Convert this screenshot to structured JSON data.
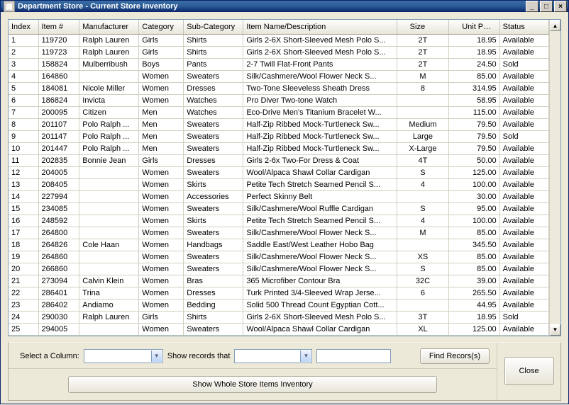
{
  "window": {
    "title": "Department Store - Current Store Inventory",
    "min_btn": "_",
    "max_btn": "□",
    "close_btn": "×"
  },
  "columns": {
    "index": "Index",
    "itemno": "Item #",
    "manufacturer": "Manufacturer",
    "category": "Category",
    "subcategory": "Sub-Category",
    "name": "Item Name/Description",
    "size": "Size",
    "unitprice": "Unit Price",
    "status": "Status"
  },
  "rows": [
    {
      "index": "1",
      "itemno": "119720",
      "manufacturer": "Ralph Lauren",
      "category": "Girls",
      "subcategory": "Shirts",
      "name": "Girls 2-6X Short-Sleeved Mesh Polo S...",
      "size": "2T",
      "unitprice": "18.95",
      "status": "Available"
    },
    {
      "index": "2",
      "itemno": "119723",
      "manufacturer": "Ralph Lauren",
      "category": "Girls",
      "subcategory": "Shirts",
      "name": "Girls 2-6X Short-Sleeved Mesh Polo S...",
      "size": "2T",
      "unitprice": "18.95",
      "status": "Available"
    },
    {
      "index": "3",
      "itemno": "158824",
      "manufacturer": "Mulberribush",
      "category": "Boys",
      "subcategory": "Pants",
      "name": "2-7 Twill Flat-Front Pants",
      "size": "2T",
      "unitprice": "24.50",
      "status": "Sold"
    },
    {
      "index": "4",
      "itemno": "164860",
      "manufacturer": "",
      "category": "Women",
      "subcategory": "Sweaters",
      "name": "Silk/Cashmere/Wool Flower Neck S...",
      "size": "M",
      "unitprice": "85.00",
      "status": "Available"
    },
    {
      "index": "5",
      "itemno": "184081",
      "manufacturer": "Nicole Miller",
      "category": "Women",
      "subcategory": "Dresses",
      "name": "Two-Tone Sleeveless Sheath Dress",
      "size": "8",
      "unitprice": "314.95",
      "status": "Available"
    },
    {
      "index": "6",
      "itemno": "186824",
      "manufacturer": "Invicta",
      "category": "Women",
      "subcategory": "Watches",
      "name": "Pro Diver Two-tone Watch",
      "size": "",
      "unitprice": "58.95",
      "status": "Available"
    },
    {
      "index": "7",
      "itemno": "200095",
      "manufacturer": "Citizen",
      "category": "Men",
      "subcategory": "Watches",
      "name": "Eco-Drive Men's Titanium Bracelet W...",
      "size": "",
      "unitprice": "115.00",
      "status": "Available"
    },
    {
      "index": "8",
      "itemno": "201107",
      "manufacturer": "Polo Ralph ...",
      "category": "Men",
      "subcategory": "Sweaters",
      "name": "Half-Zip Ribbed Mock-Turtleneck Sw...",
      "size": "Medium",
      "unitprice": "79.50",
      "status": "Available"
    },
    {
      "index": "9",
      "itemno": "201147",
      "manufacturer": "Polo Ralph ...",
      "category": "Men",
      "subcategory": "Sweaters",
      "name": "Half-Zip Ribbed Mock-Turtleneck Sw...",
      "size": "Large",
      "unitprice": "79.50",
      "status": "Sold"
    },
    {
      "index": "10",
      "itemno": "201447",
      "manufacturer": "Polo Ralph ...",
      "category": "Men",
      "subcategory": "Sweaters",
      "name": "Half-Zip Ribbed Mock-Turtleneck Sw...",
      "size": "X-Large",
      "unitprice": "79.50",
      "status": "Available"
    },
    {
      "index": "11",
      "itemno": "202835",
      "manufacturer": "Bonnie Jean",
      "category": "Girls",
      "subcategory": "Dresses",
      "name": "Girls 2-6x Two-For Dress & Coat",
      "size": "4T",
      "unitprice": "50.00",
      "status": "Available"
    },
    {
      "index": "12",
      "itemno": "204005",
      "manufacturer": "",
      "category": "Women",
      "subcategory": "Sweaters",
      "name": "Wool/Alpaca Shawl Collar Cardigan",
      "size": "S",
      "unitprice": "125.00",
      "status": "Available"
    },
    {
      "index": "13",
      "itemno": "208405",
      "manufacturer": "",
      "category": "Women",
      "subcategory": "Skirts",
      "name": "Petite Tech Stretch Seamed Pencil S...",
      "size": "4",
      "unitprice": "100.00",
      "status": "Available"
    },
    {
      "index": "14",
      "itemno": "227994",
      "manufacturer": "",
      "category": "Women",
      "subcategory": "Accessories",
      "name": "Perfect Skinny Belt",
      "size": "",
      "unitprice": "30.00",
      "status": "Available"
    },
    {
      "index": "15",
      "itemno": "234085",
      "manufacturer": "",
      "category": "Women",
      "subcategory": "Sweaters",
      "name": "Silk/Cashmere/Wool Ruffle Cardigan",
      "size": "S",
      "unitprice": "95.00",
      "status": "Available"
    },
    {
      "index": "16",
      "itemno": "248592",
      "manufacturer": "",
      "category": "Women",
      "subcategory": "Skirts",
      "name": "Petite Tech Stretch Seamed Pencil S...",
      "size": "4",
      "unitprice": "100.00",
      "status": "Available"
    },
    {
      "index": "17",
      "itemno": "264800",
      "manufacturer": "",
      "category": "Women",
      "subcategory": "Sweaters",
      "name": "Silk/Cashmere/Wool Flower Neck S...",
      "size": "M",
      "unitprice": "85.00",
      "status": "Available"
    },
    {
      "index": "18",
      "itemno": "264826",
      "manufacturer": "Cole Haan",
      "category": "Women",
      "subcategory": "Handbags",
      "name": "Saddle East/West Leather Hobo Bag",
      "size": "",
      "unitprice": "345.50",
      "status": "Available"
    },
    {
      "index": "19",
      "itemno": "264860",
      "manufacturer": "",
      "category": "Women",
      "subcategory": "Sweaters",
      "name": "Silk/Cashmere/Wool Flower Neck S...",
      "size": "XS",
      "unitprice": "85.00",
      "status": "Available"
    },
    {
      "index": "20",
      "itemno": "266860",
      "manufacturer": "",
      "category": "Women",
      "subcategory": "Sweaters",
      "name": "Silk/Cashmere/Wool Flower Neck S...",
      "size": "S",
      "unitprice": "85.00",
      "status": "Available"
    },
    {
      "index": "21",
      "itemno": "273094",
      "manufacturer": "Calvin Klein",
      "category": "Women",
      "subcategory": "Bras",
      "name": "365 Microfiber Contour Bra",
      "size": "32C",
      "unitprice": "39.00",
      "status": "Available"
    },
    {
      "index": "22",
      "itemno": "286401",
      "manufacturer": "Trina",
      "category": "Women",
      "subcategory": "Dresses",
      "name": "Turk Printed 3/4-Sleeved Wrap Jerse...",
      "size": "6",
      "unitprice": "265.50",
      "status": "Available"
    },
    {
      "index": "23",
      "itemno": "286402",
      "manufacturer": "Andiamo",
      "category": "Women",
      "subcategory": "Bedding",
      "name": "Solid 500 Thread Count Egyptian Cott...",
      "size": "",
      "unitprice": "44.95",
      "status": "Available"
    },
    {
      "index": "24",
      "itemno": "290030",
      "manufacturer": "Ralph Lauren",
      "category": "Girls",
      "subcategory": "Shirts",
      "name": "Girls 2-6X Short-Sleeved Mesh Polo S...",
      "size": "3T",
      "unitprice": "18.95",
      "status": "Sold"
    },
    {
      "index": "25",
      "itemno": "294005",
      "manufacturer": "",
      "category": "Women",
      "subcategory": "Sweaters",
      "name": "Wool/Alpaca Shawl Collar Cardigan",
      "size": "XL",
      "unitprice": "125.00",
      "status": "Available"
    }
  ],
  "filter": {
    "select_label": "Select a Column:",
    "show_label": "Show records that",
    "find_btn": "Find Recors(s)",
    "show_all_btn": "Show Whole Store Items Inventory",
    "close_btn": "Close"
  }
}
